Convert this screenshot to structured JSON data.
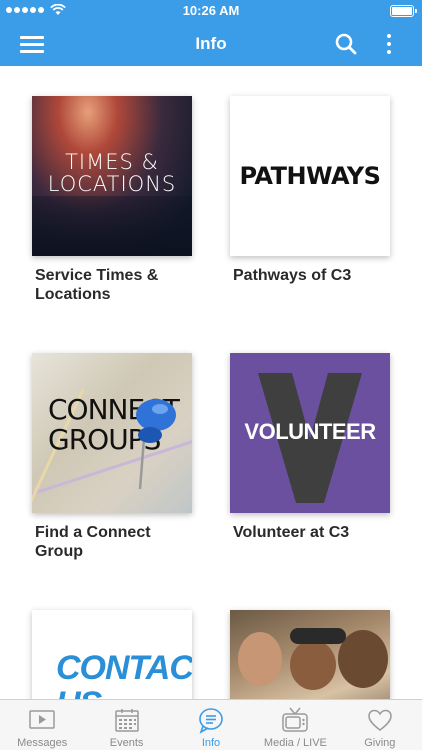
{
  "status_bar": {
    "time": "10:26 AM"
  },
  "nav": {
    "title": "Info"
  },
  "cards": [
    {
      "label": "Service Times & Locations",
      "image_text": "TIMES & LOCATIONS"
    },
    {
      "label": "Pathways of C3",
      "image_text": "PATHWAYS"
    },
    {
      "label": "Find a Connect Group",
      "image_text": "CONNECT GROUPS"
    },
    {
      "label": "Volunteer at C3",
      "image_text": "VOLUNTEER"
    },
    {
      "label": "",
      "image_text": "CONTACT US"
    },
    {
      "label": "",
      "image_text": ""
    }
  ],
  "tabs": [
    {
      "label": "Messages",
      "icon": "video-icon",
      "active": false
    },
    {
      "label": "Events",
      "icon": "calendar-icon",
      "active": false
    },
    {
      "label": "Info",
      "icon": "chat-bubble-icon",
      "active": true
    },
    {
      "label": "Media / LIVE",
      "icon": "tv-icon",
      "active": false
    },
    {
      "label": "Giving",
      "icon": "heart-icon",
      "active": false
    }
  ],
  "colors": {
    "primary": "#3b9ce8",
    "volunteer_bg": "#6b50a0",
    "contact_blue": "#2a8fd6"
  }
}
